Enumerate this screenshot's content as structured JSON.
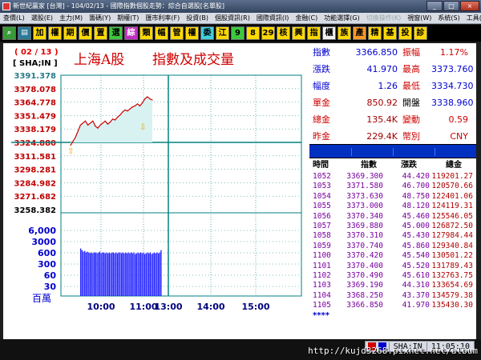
{
  "window": {
    "title": "新世紀贏家 [台灣] - 104/02/13 - 國際指數個股走勢：綜合自選股[名單股]",
    "btn_min": "_",
    "btn_max": "□",
    "btn_close": "×"
  },
  "menu": [
    "查價(L)",
    "選股(E)",
    "主力(M)",
    "籌碼(Y)",
    "期權(T)",
    "匯市利率(F)",
    "投資(B)",
    "個股資訊(R)",
    "國際資訊(I)",
    "金融(C)",
    "功能選擇(G)",
    "切換操作(K)",
    "視窗(W)",
    "系統(S)",
    "工具(T)",
    "說明(H)"
  ],
  "toolbar": {
    "icons": [
      "search-icon",
      "document-icon"
    ],
    "buttons": [
      {
        "label": "加",
        "color": "y"
      },
      {
        "label": "權",
        "color": "y"
      },
      {
        "label": "期",
        "color": "y"
      },
      {
        "label": "價",
        "color": "y"
      },
      {
        "label": "置",
        "color": "y"
      },
      {
        "label": "選",
        "color": "g"
      },
      {
        "label": "綜",
        "color": "p"
      },
      {
        "label": "類",
        "color": "y"
      },
      {
        "label": "幅",
        "color": "y"
      },
      {
        "label": "管",
        "color": "y"
      },
      {
        "label": "權",
        "color": "y"
      },
      {
        "label": "委",
        "color": "c"
      },
      {
        "label": "江",
        "color": "y"
      },
      {
        "label": "9",
        "color": "g"
      },
      {
        "label": "8",
        "color": "y"
      },
      {
        "label": "29",
        "color": "y"
      },
      {
        "label": "核",
        "color": "y"
      },
      {
        "label": "興",
        "color": "y"
      },
      {
        "label": "指",
        "color": "y"
      },
      {
        "label": "櫃",
        "color": "w"
      },
      {
        "label": "族",
        "color": "y"
      },
      {
        "label": "產",
        "color": "o"
      },
      {
        "label": "精",
        "color": "y"
      },
      {
        "label": "基",
        "color": "y"
      },
      {
        "label": "投",
        "color": "y"
      },
      {
        "label": "診",
        "color": "y"
      }
    ]
  },
  "chart": {
    "date_label": "( 02 / 13 )",
    "code_label": "[ SHA;IN ]",
    "name": "上海A股",
    "description": "指數及成交量",
    "unit_label": "百萬"
  },
  "chart_data": {
    "type": "line",
    "ylim": [
      3258.382,
      3391.378
    ],
    "y_ticks": [
      "3391.378",
      "3378.078",
      "3364.778",
      "3351.479",
      "3338.179",
      "3324.880",
      "3311.581",
      "3298.281",
      "3284.982",
      "3271.682",
      "3258.382"
    ],
    "reference_value": 3324.88,
    "x_ticks": [
      "10:00",
      "11:00",
      "13:00",
      "14:00",
      "15:00"
    ],
    "volume_ticks": [
      "6,000",
      "3000",
      "600",
      "300",
      "60",
      "30"
    ],
    "series": [
      {
        "values": [
          3322.0,
          3326.0,
          3330.0,
          3336.0,
          3342.0,
          3344.0,
          3346.0,
          3342.0,
          3344.0,
          3346.0,
          3341.0,
          3339.0,
          3342.0,
          3344.0,
          3346.0,
          3343.0,
          3345.0,
          3348.0,
          3347.0,
          3350.0,
          3352.0,
          3355.0,
          3357.0,
          3356.0,
          3358.0,
          3360.0,
          3361.0,
          3363.0,
          3361.0,
          3364.0,
          3368.0,
          3370.0,
          3368.0,
          3366.85
        ]
      }
    ],
    "volume": [
      60,
      58,
      56,
      57,
      55,
      56,
      55,
      54,
      55,
      54,
      55,
      55,
      54,
      55,
      56,
      54,
      55,
      55,
      54,
      55,
      54,
      55,
      54,
      55,
      55,
      54,
      55,
      54,
      55,
      55,
      54,
      55,
      54,
      55,
      54,
      55,
      54,
      55,
      54,
      55,
      53,
      54,
      55,
      54,
      55,
      54,
      55,
      53,
      54,
      55,
      54,
      55,
      53,
      54,
      55,
      54,
      55,
      54,
      55,
      58
    ]
  },
  "quote": [
    {
      "label": "指數",
      "value": "3366.850",
      "label2": "振幅",
      "value2": "1.17%"
    },
    {
      "label": "漲跌",
      "value": "41.970",
      "label2": "最高",
      "value2": "3373.760"
    },
    {
      "label": "幅度",
      "value": "1.26",
      "label2": "最低",
      "value2": "3334.730"
    },
    {
      "label": "單金",
      "value": "850.92",
      "label2": "開盤",
      "value2": "3338.960"
    },
    {
      "label": "總金",
      "value": "135.4K",
      "label2": "變動",
      "value2": "0.59"
    },
    {
      "label": "昨金",
      "value": "229.4K",
      "label2": "幣別",
      "value2": "CNY"
    }
  ],
  "ticks": {
    "headers": [
      "時間",
      "指數",
      "漲跌",
      "總金"
    ],
    "rows": [
      [
        "1052",
        "3369.300",
        "44.420",
        "119201.27"
      ],
      [
        "1053",
        "3371.580",
        "46.700",
        "120570.66"
      ],
      [
        "1054",
        "3373.630",
        "48.750",
        "122401.06"
      ],
      [
        "1055",
        "3373.000",
        "48.120",
        "124119.31"
      ],
      [
        "1056",
        "3370.340",
        "45.460",
        "125546.05"
      ],
      [
        "1057",
        "3369.880",
        "45.000",
        "126872.50"
      ],
      [
        "1058",
        "3370.310",
        "45.430",
        "127984.44"
      ],
      [
        "1059",
        "3370.740",
        "45.860",
        "129340.84"
      ],
      [
        "1100",
        "3370.420",
        "45.540",
        "130501.22"
      ],
      [
        "1101",
        "3370.400",
        "45.520",
        "131789.43"
      ],
      [
        "1102",
        "3370.490",
        "45.610",
        "132763.75"
      ],
      [
        "1103",
        "3369.190",
        "44.310",
        "133654.69"
      ],
      [
        "1104",
        "3368.250",
        "43.370",
        "134579.38"
      ],
      [
        "1105",
        "3366.850",
        "41.970",
        "135430.30"
      ]
    ],
    "end_marker": "****"
  },
  "status": {
    "code": "SHA;IN",
    "time": "11:05:10"
  },
  "watermark": "http://kujd3268.pixnet.net/album",
  "colors": {
    "grid": "#008080",
    "reference": "#008080",
    "line": "#cc0000",
    "area": "#d8f2f2",
    "volume": "#2020ff"
  }
}
